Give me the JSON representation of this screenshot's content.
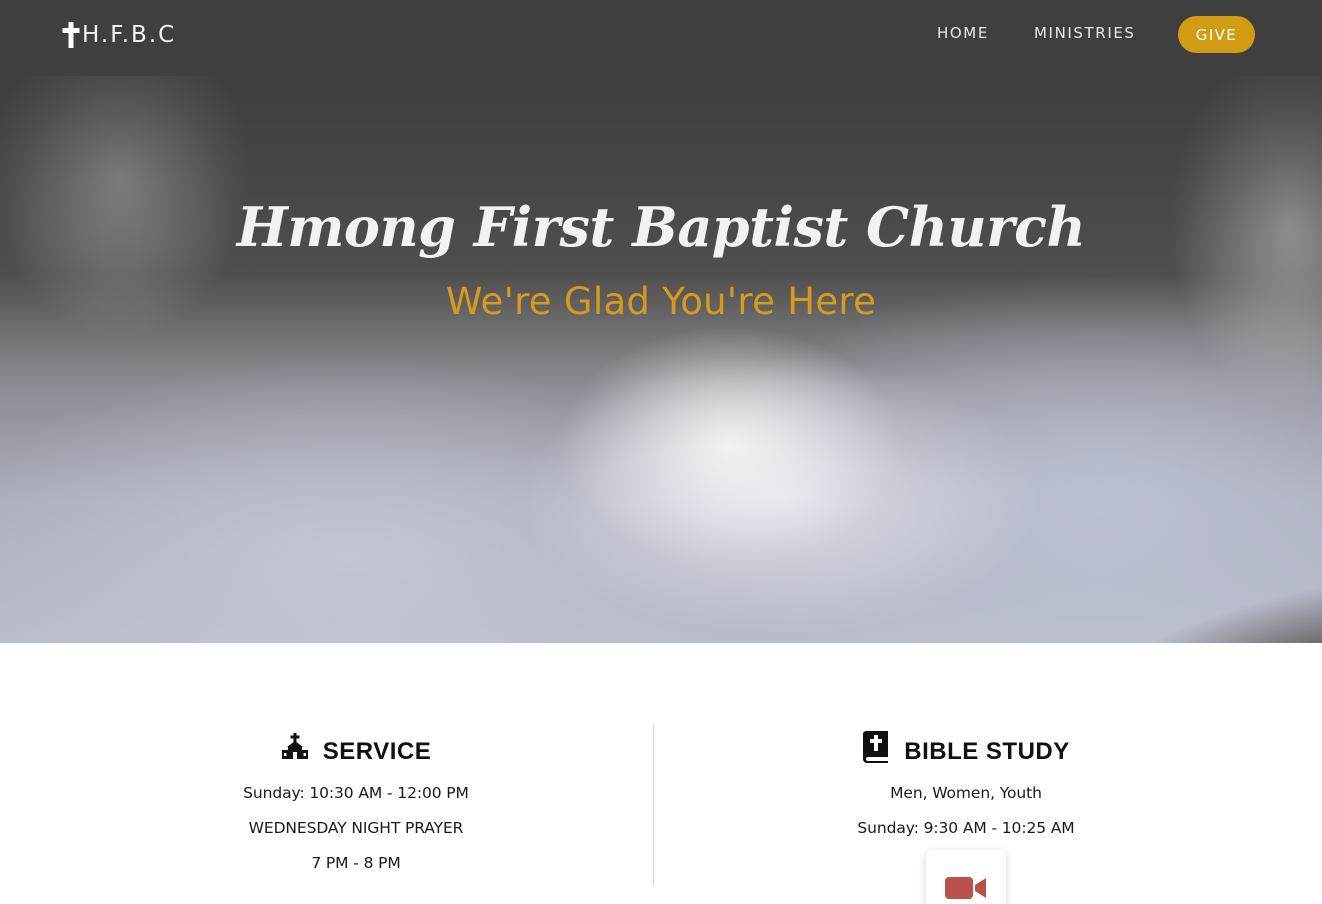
{
  "header": {
    "logo_text": "H.F.B.C",
    "nav": {
      "home": "HOME",
      "ministries": "MINISTRIES",
      "give": "GIVE"
    }
  },
  "hero": {
    "title": "Hmong First Baptist Church",
    "subtitle": "We're Glad You're Here"
  },
  "service": {
    "icon": "church-icon",
    "title": "SERVICE",
    "lines": [
      "Sunday: 10:30 AM - 12:00 PM",
      "WEDNESDAY NIGHT PRAYER",
      "7 PM - 8 PM"
    ]
  },
  "bible_study": {
    "icon": "bible-icon",
    "title": "BIBLE STUDY",
    "lines": [
      "Men, Women, Youth",
      "Sunday: 9:30 AM - 10:25 AM"
    ],
    "video_icon": "video-camera-icon"
  },
  "colors": {
    "nav_bg": "#3f3f3f",
    "accent_gold": "#d29b14",
    "subtitle_gold": "#d69a1d",
    "video_red": "#b8514c"
  }
}
